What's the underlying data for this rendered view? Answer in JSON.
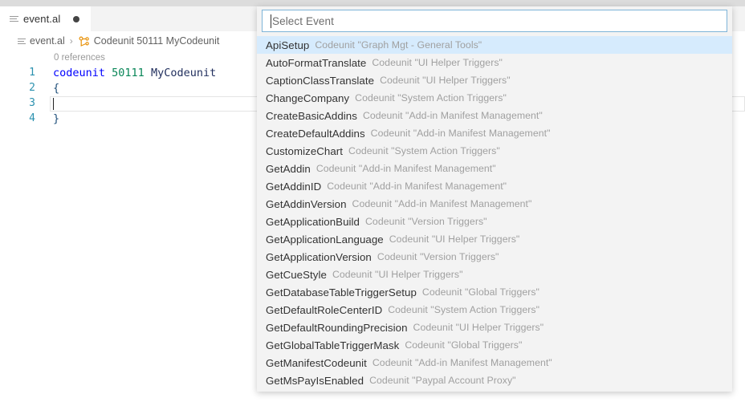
{
  "window": {
    "title": "event.al"
  },
  "tab": {
    "label": "event.al",
    "file_icon": "file-lines-icon",
    "dirty_indicator": "●"
  },
  "breadcrumb": {
    "file_icon": "file-lines-icon",
    "file": "event.al",
    "separator": "›",
    "symbol_icon": "codeunit-symbol-icon",
    "symbol": "Codeunit 50111 MyCodeunit"
  },
  "editor": {
    "codelens": "0 references",
    "line_numbers": [
      "1",
      "2",
      "3",
      "4"
    ],
    "lines": [
      {
        "keyword": "codeunit",
        "number": "50111",
        "identifier": "MyCodeunit"
      },
      {
        "brace": "{"
      },
      {
        "empty": ""
      },
      {
        "brace": "}"
      }
    ]
  },
  "suggest": {
    "placeholder": "Select Event",
    "value": "",
    "selected_index": 0,
    "items": [
      {
        "name": "ApiSetup",
        "detail": "Codeunit \"Graph Mgt - General Tools\""
      },
      {
        "name": "AutoFormatTranslate",
        "detail": "Codeunit \"UI Helper Triggers\""
      },
      {
        "name": "CaptionClassTranslate",
        "detail": "Codeunit \"UI Helper Triggers\""
      },
      {
        "name": "ChangeCompany",
        "detail": "Codeunit \"System Action Triggers\""
      },
      {
        "name": "CreateBasicAddins",
        "detail": "Codeunit \"Add-in Manifest Management\""
      },
      {
        "name": "CreateDefaultAddins",
        "detail": "Codeunit \"Add-in Manifest Management\""
      },
      {
        "name": "CustomizeChart",
        "detail": "Codeunit \"System Action Triggers\""
      },
      {
        "name": "GetAddin",
        "detail": "Codeunit \"Add-in Manifest Management\""
      },
      {
        "name": "GetAddinID",
        "detail": "Codeunit \"Add-in Manifest Management\""
      },
      {
        "name": "GetAddinVersion",
        "detail": "Codeunit \"Add-in Manifest Management\""
      },
      {
        "name": "GetApplicationBuild",
        "detail": "Codeunit \"Version Triggers\""
      },
      {
        "name": "GetApplicationLanguage",
        "detail": "Codeunit \"UI Helper Triggers\""
      },
      {
        "name": "GetApplicationVersion",
        "detail": "Codeunit \"Version Triggers\""
      },
      {
        "name": "GetCueStyle",
        "detail": "Codeunit \"UI Helper Triggers\""
      },
      {
        "name": "GetDatabaseTableTriggerSetup",
        "detail": "Codeunit \"Global Triggers\""
      },
      {
        "name": "GetDefaultRoleCenterID",
        "detail": "Codeunit \"System Action Triggers\""
      },
      {
        "name": "GetDefaultRoundingPrecision",
        "detail": "Codeunit \"UI Helper Triggers\""
      },
      {
        "name": "GetGlobalTableTriggerMask",
        "detail": "Codeunit \"Global Triggers\""
      },
      {
        "name": "GetManifestCodeunit",
        "detail": "Codeunit \"Add-in Manifest Management\""
      },
      {
        "name": "GetMsPayIsEnabled",
        "detail": "Codeunit \"Paypal Account Proxy\""
      }
    ]
  },
  "colors": {
    "selection": "#d6ebfd",
    "input_border": "#7eb4d8",
    "panel_bg": "#f3f3f3",
    "symbol_icon": "#e8920a",
    "keyword": "#0000ff",
    "number": "#098658",
    "line_number": "#2b91af"
  }
}
